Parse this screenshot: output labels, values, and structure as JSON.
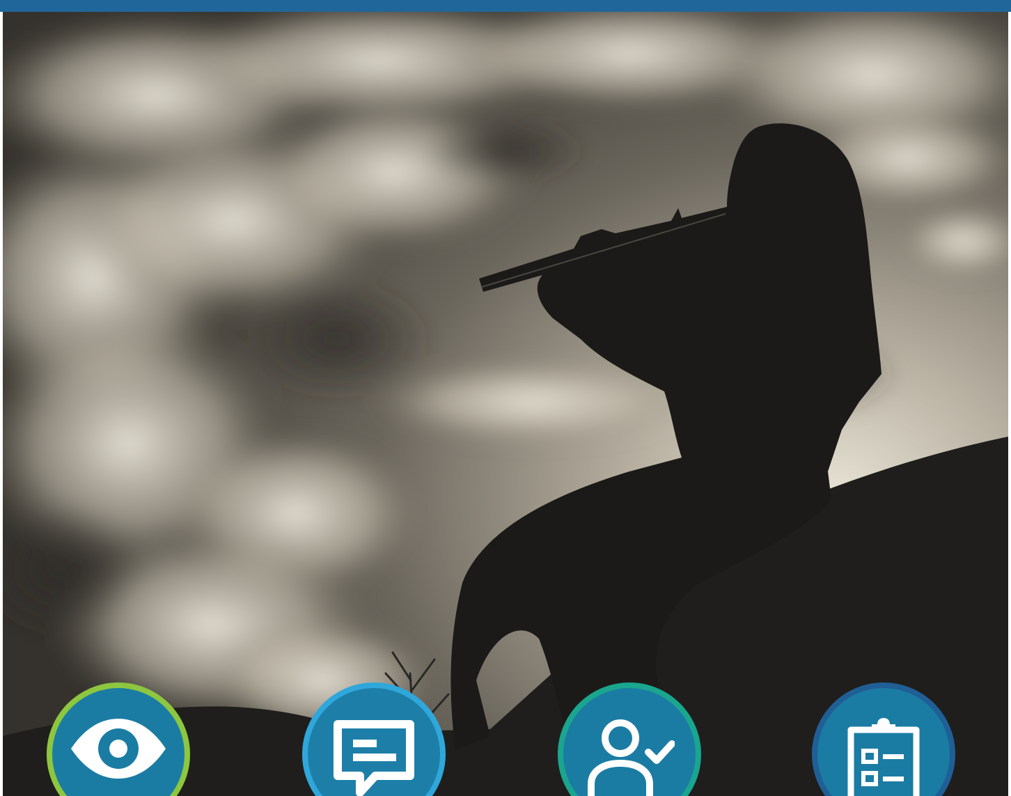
{
  "page": {
    "header_bar_color": "#20669b",
    "hero_image": {
      "description_name": "flute-player-silhouette-photo",
      "tone": "sepia"
    }
  },
  "feature_icons": [
    {
      "icon": "eye-icon",
      "ring_color": "#8dc63f",
      "fill_color": "#1b7ca3"
    },
    {
      "icon": "chat-message-icon",
      "ring_color": "#2fa7db",
      "fill_color": "#1d7fa8"
    },
    {
      "icon": "user-check-icon",
      "ring_color": "#1aa58f",
      "fill_color": "#1b7ca3"
    },
    {
      "icon": "clipboard-checklist-icon",
      "ring_color": "#1f5f96",
      "fill_color": "#1b7ca3"
    }
  ]
}
